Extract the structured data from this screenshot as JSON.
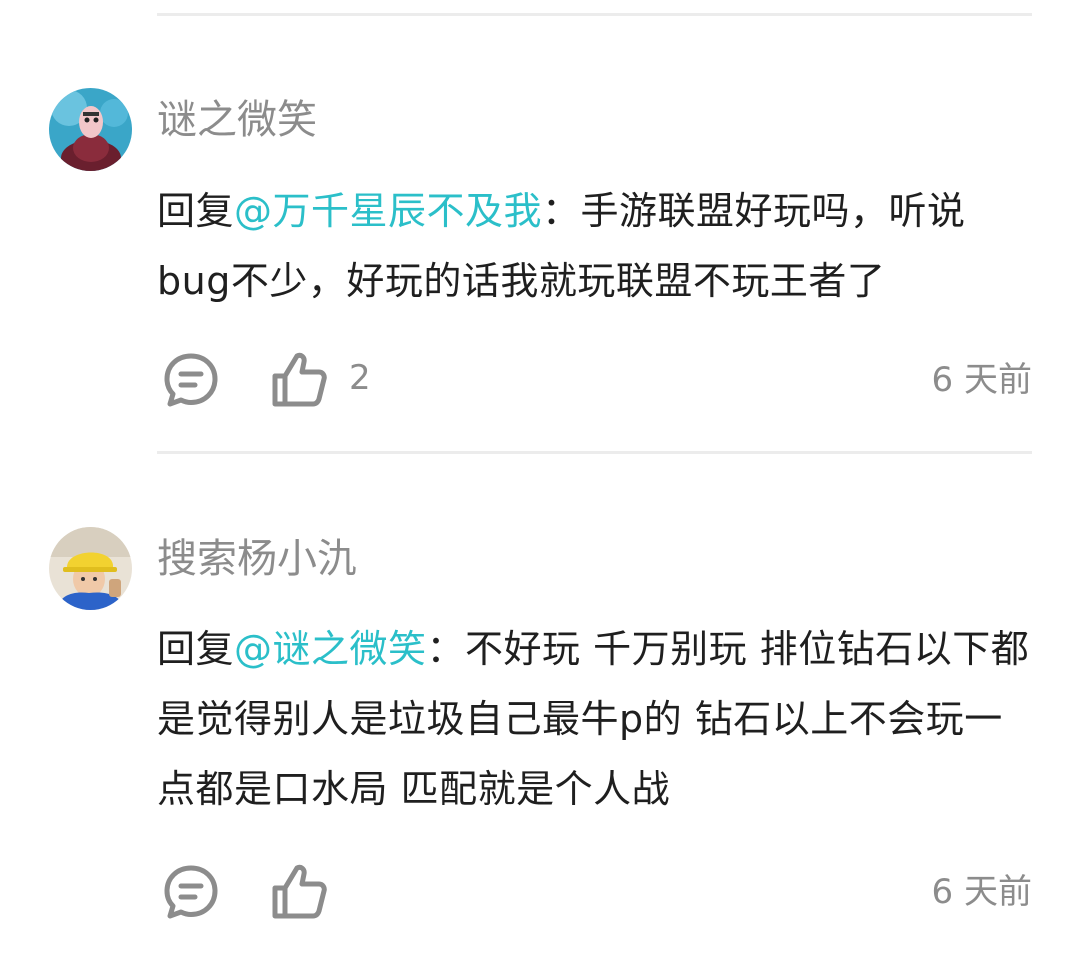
{
  "comments": [
    {
      "username": "谜之微笑",
      "reply_prefix": "回复",
      "mention": "@万千星辰不及我",
      "separator": "：",
      "text": "手游联盟好玩吗，听说bug不少，好玩的话我就玩联盟不玩王者了",
      "like_count": "2",
      "time": "6 天前",
      "avatar_icon": "cartoon-character-avatar"
    },
    {
      "username": "搜索杨小氿",
      "reply_prefix": "回复",
      "mention": "@谜之微笑",
      "separator": "：",
      "text": "不好玩 千万别玩 排位钻石以下都是觉得别人是垃圾自己最牛p的 钻石以上不会玩一点都是口水局 匹配就是个人战",
      "like_count": "",
      "time": "6 天前",
      "avatar_icon": "boy-yellow-hat-avatar"
    }
  ],
  "colors": {
    "mention": "#2bbfc9",
    "username": "#8c8c8c",
    "text": "#1f1f1f",
    "icon": "#8c8c8c",
    "divider": "#ececec"
  },
  "icons": {
    "comment": "comment-bubble-icon",
    "like": "thumbs-up-icon"
  }
}
